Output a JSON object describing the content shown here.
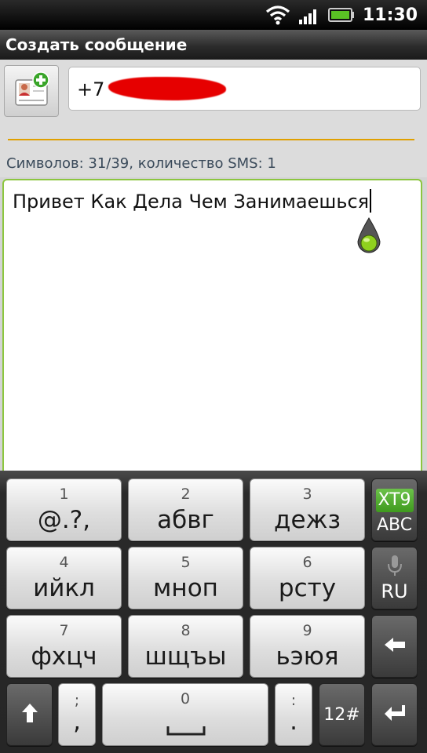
{
  "status_bar": {
    "time": "11:30",
    "icons": [
      "wifi-icon",
      "signal-icon",
      "battery-icon"
    ]
  },
  "title_bar": {
    "title": "Создать сообщение"
  },
  "compose": {
    "recipient_prefix": "+7",
    "counter": "Символов: 31/39, количество SMS: 1",
    "message_text": "Привет Как Дела Чем Занимаешься"
  },
  "keyboard": {
    "rows": [
      [
        {
          "num": "1",
          "label": "@.?,"
        },
        {
          "num": "2",
          "label": "абвг"
        },
        {
          "num": "3",
          "label": "дежз"
        }
      ],
      [
        {
          "num": "4",
          "label": "ийкл"
        },
        {
          "num": "5",
          "label": "мноп"
        },
        {
          "num": "6",
          "label": "рсту"
        }
      ],
      [
        {
          "num": "7",
          "label": "фхцч"
        },
        {
          "num": "8",
          "label": "шщъы"
        },
        {
          "num": "9",
          "label": "ьэюя"
        }
      ]
    ],
    "xt9_label": "XT9",
    "abc_label": "ABC",
    "lang_label": "RU",
    "semicolon_top": ";",
    "comma_label": ",",
    "space_num": "0",
    "colon_top": ":",
    "dot_label": ".",
    "numeric_label": "12#"
  },
  "colors": {
    "accent_green": "#8cc63f",
    "divider_orange": "#e0a000",
    "redaction_red": "#e60000"
  }
}
